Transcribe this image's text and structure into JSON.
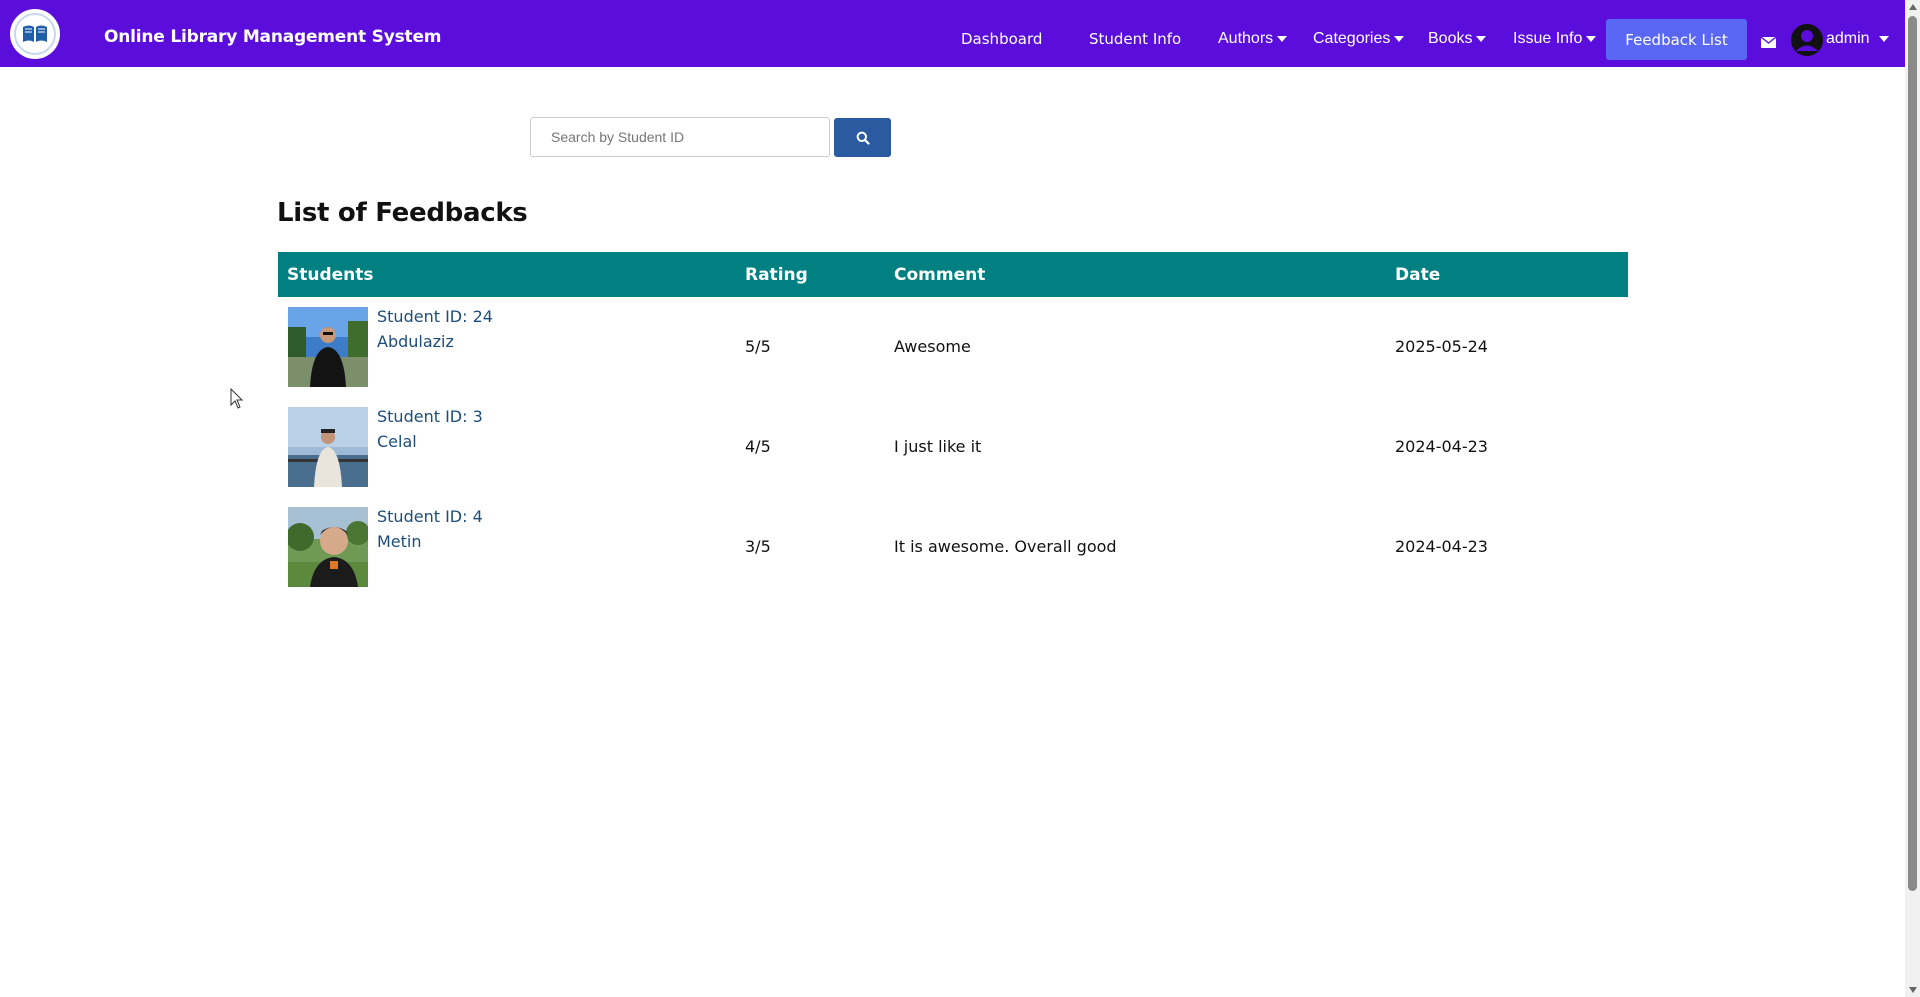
{
  "header": {
    "brand": "Online Library Management System",
    "nav": {
      "dashboard": "Dashboard",
      "student_info": "Student Info",
      "authors": "Authors",
      "categories": "Categories",
      "books": "Books",
      "issue_info": "Issue Info",
      "feedback_list": "Feedback List",
      "user": "admin"
    },
    "colors": {
      "navbar": "#5b0ddb",
      "active_button": "#5a66f4"
    }
  },
  "search": {
    "placeholder": "Search by Student ID",
    "value": ""
  },
  "main": {
    "title": "List of Feedbacks",
    "columns": [
      "Students",
      "Rating",
      "Comment",
      "Date"
    ],
    "rows": [
      {
        "student_id": "Student ID: 24",
        "name": "Abdulaziz",
        "rating": "5/5",
        "comment": "Awesome",
        "date": "2025-05-24"
      },
      {
        "student_id": "Student ID: 3",
        "name": "Celal",
        "rating": "4/5",
        "comment": "I just like it",
        "date": "2024-04-23"
      },
      {
        "student_id": "Student ID: 4",
        "name": "Metin",
        "rating": "3/5",
        "comment": "It is awesome. Overall good",
        "date": "2024-04-23"
      }
    ],
    "colors": {
      "table_header": "#008080",
      "link": "#1e4d7a"
    }
  }
}
